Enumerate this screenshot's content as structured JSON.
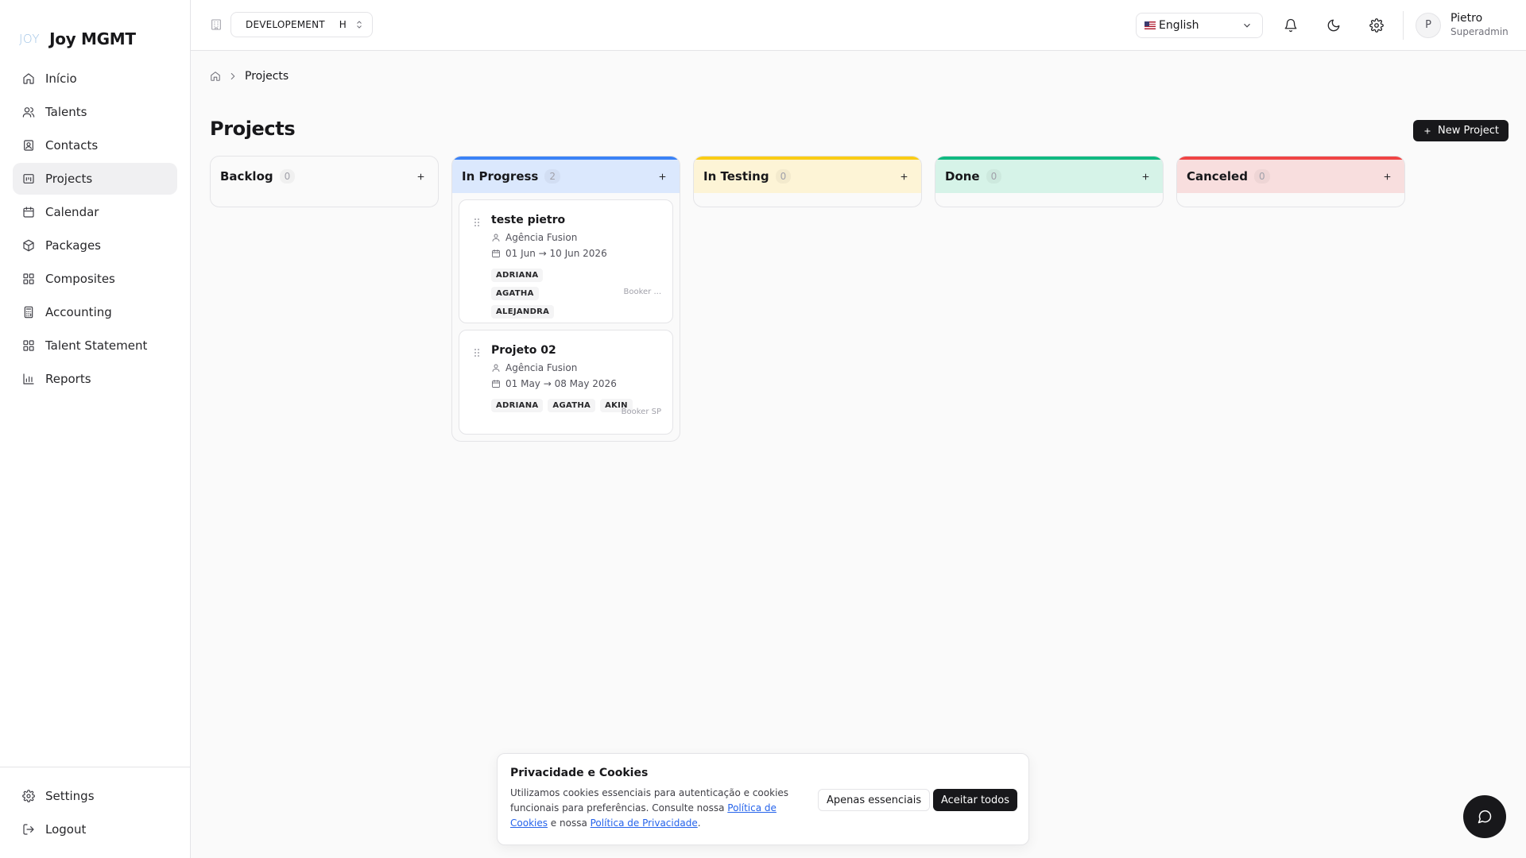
{
  "brand": {
    "logo": "JOY",
    "name": "Joy MGMT"
  },
  "sidebar": {
    "items": [
      {
        "label": "Início",
        "icon": "home-icon"
      },
      {
        "label": "Talents",
        "icon": "users-icon"
      },
      {
        "label": "Contacts",
        "icon": "contact-icon"
      },
      {
        "label": "Projects",
        "icon": "folder-icon",
        "active": true
      },
      {
        "label": "Calendar",
        "icon": "calendar-icon"
      },
      {
        "label": "Packages",
        "icon": "package-icon"
      },
      {
        "label": "Composites",
        "icon": "grid-icon"
      },
      {
        "label": "Accounting",
        "icon": "calculator-icon"
      },
      {
        "label": "Talent Statement",
        "icon": "grid-icon"
      },
      {
        "label": "Reports",
        "icon": "chart-icon"
      }
    ],
    "footer": [
      {
        "label": "Settings",
        "icon": "gear-icon"
      },
      {
        "label": "Logout",
        "icon": "logout-icon"
      }
    ]
  },
  "topbar": {
    "environment": "DEVELOPEMENT",
    "environment_suffix": "H",
    "language": "English",
    "user": {
      "initial": "P",
      "name": "Pietro",
      "role": "Superadmin"
    }
  },
  "breadcrumb": {
    "current": "Projects"
  },
  "page": {
    "title": "Projects",
    "new_button": "New Project"
  },
  "colors": {
    "backlog": "#e4e4e7",
    "in_progress": "#3b82f6",
    "in_testing": "#facc15",
    "done": "#10b981",
    "canceled": "#ef4444"
  },
  "columns": [
    {
      "title": "Backlog",
      "count": "0"
    },
    {
      "title": "In Progress",
      "count": "2"
    },
    {
      "title": "In Testing",
      "count": "0"
    },
    {
      "title": "Done",
      "count": "0"
    },
    {
      "title": "Canceled",
      "count": "0"
    }
  ],
  "cards": [
    {
      "title": "teste pietro",
      "client": "Agência Fusion",
      "dates": "01 Jun → 10 Jun 2026",
      "tags": [
        "ADRIANA",
        "AGATHA",
        "ALEJANDRA"
      ],
      "booker": "Booker ..."
    },
    {
      "title": "Projeto 02",
      "client": "Agência Fusion",
      "dates": "01 May → 08 May 2026",
      "tags": [
        "ADRIANA",
        "AGATHA",
        "AKIN"
      ],
      "booker": "Booker SP"
    }
  ],
  "cookie": {
    "title": "Privacidade e Cookies",
    "text_1": "Utilizamos cookies essenciais para autenticação e cookies funcionais para preferências. Consulte nossa ",
    "link_1": "Política de Cookies",
    "text_2": " e nossa ",
    "link_2": "Política de Privacidade",
    "text_3": ".",
    "btn_essential": "Apenas essenciais",
    "btn_accept": "Aceitar todos"
  }
}
